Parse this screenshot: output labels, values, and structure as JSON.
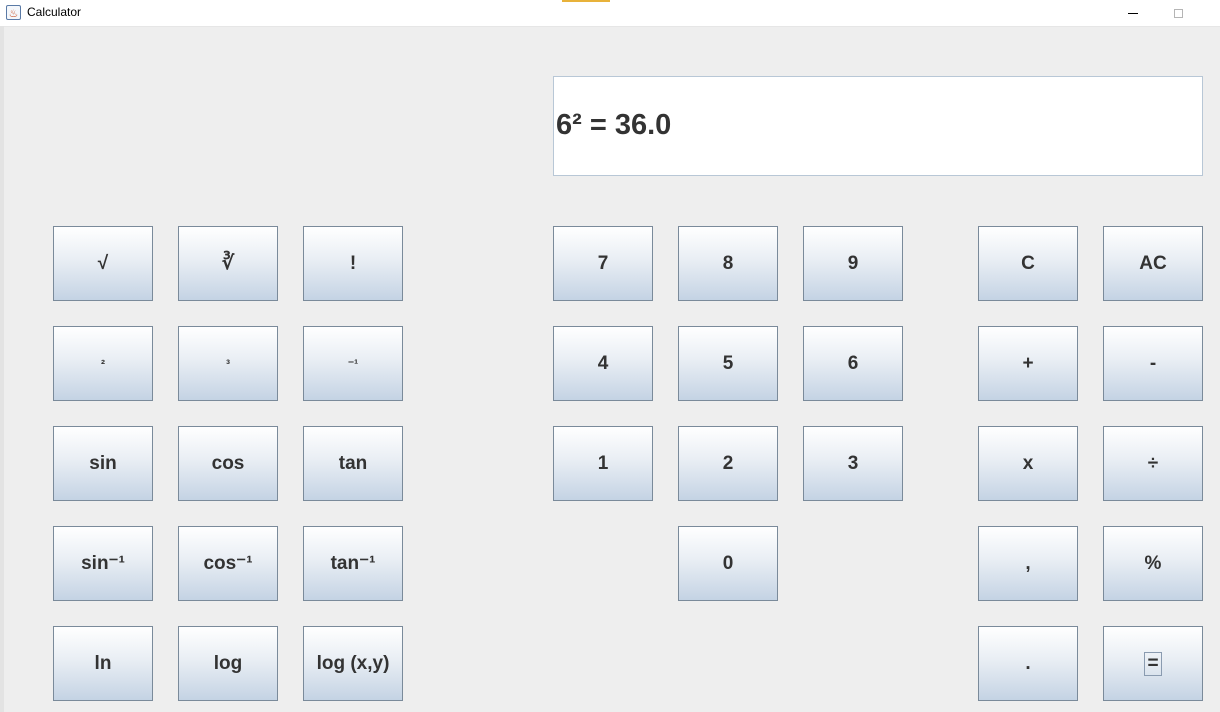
{
  "window": {
    "title": "Calculator",
    "icon": "java-cup-icon"
  },
  "display": {
    "text": "6² = 36.0"
  },
  "keys": {
    "sqrt": "√",
    "cbrt": "∛",
    "factorial": "!",
    "square": "²",
    "cube": "³",
    "inverse": "⁻¹",
    "sin": "sin",
    "cos": "cos",
    "tan": "tan",
    "asin": "sin⁻¹",
    "acos": "cos⁻¹",
    "atan": "tan⁻¹",
    "ln": "ln",
    "log": "log",
    "logxy": "log (x,y)",
    "d7": "7",
    "d8": "8",
    "d9": "9",
    "d4": "4",
    "d5": "5",
    "d6": "6",
    "d1": "1",
    "d2": "2",
    "d3": "3",
    "d0": "0",
    "clear": "C",
    "all_clear": "AC",
    "plus": "+",
    "minus": "-",
    "multiply": "x",
    "divide": "÷",
    "comma": ",",
    "percent": "%",
    "decimal": ".",
    "equals": "="
  }
}
